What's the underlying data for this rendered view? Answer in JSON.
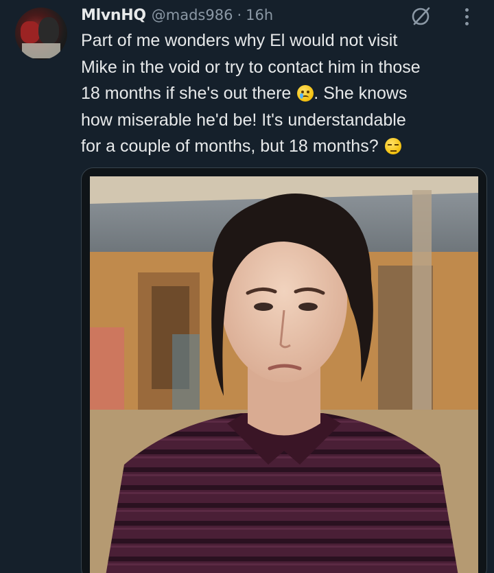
{
  "tweet": {
    "author_name": "MlvnHQ",
    "author_handle": "@mads986",
    "separator": "·",
    "timestamp": "16h",
    "text_lines": [
      "Part of me wonders why El would not visit",
      "Mike in the void or try to contact him in those",
      "18 months if she's out there",
      ". She knows",
      "how miserable he'd be! It's understandable",
      "for a couple of months, but 18 months?"
    ],
    "emoji": {
      "sad": "crying-face-emoji",
      "unamused": "unamused-face-emoji"
    }
  },
  "icons": {
    "grok": "grok-icon",
    "more": "more-options-icon"
  },
  "colors": {
    "background": "#15202b",
    "text_primary": "#e7e9ea",
    "text_secondary": "#8b98a5",
    "border": "#38444d"
  }
}
